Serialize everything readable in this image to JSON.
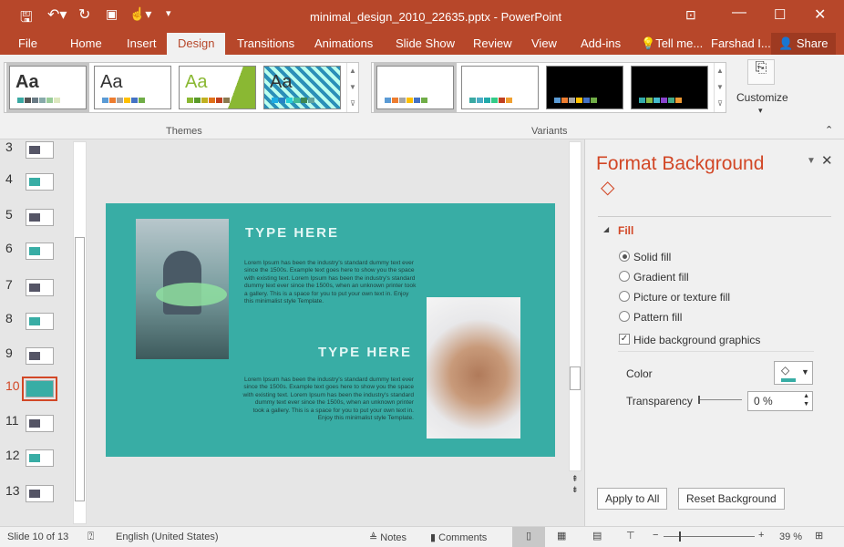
{
  "window": {
    "title": "minimal_design_2010_22635.pptx - PowerPoint"
  },
  "tabs": [
    "File",
    "Home",
    "Insert",
    "Design",
    "Transitions",
    "Animations",
    "Slide Show",
    "Review",
    "View",
    "Add-ins",
    "Tell me...",
    "Farshad I...",
    "Share"
  ],
  "active_tab": "Design",
  "ribbon": {
    "themes_label": "Themes",
    "variants_label": "Variants",
    "customize_label": "Customize",
    "themes": [
      {
        "aa": "Aa",
        "colors": [
          "#3aa9a3",
          "#555",
          "#6a7b85",
          "#8aa",
          "#9c9",
          "#dde8c0"
        ]
      },
      {
        "aa": "Aa",
        "colors": [
          "#5b9bd5",
          "#ed7d31",
          "#a5a5a5",
          "#ffc000",
          "#4472c4",
          "#70ad47"
        ]
      },
      {
        "aa": "Aa",
        "colors": [
          "#8ab833",
          "#5a9a2a",
          "#c0b020",
          "#e0701a",
          "#c04020",
          "#8a7a50"
        ]
      },
      {
        "aa": "Aa",
        "colors": [
          "#1cade4",
          "#2683c6",
          "#27ced7",
          "#42ba97",
          "#3e8853",
          "#62a39f"
        ]
      }
    ],
    "variants": [
      {
        "bg": "#ffffff",
        "colors": [
          "#5b9bd5",
          "#ed7d31",
          "#a5a5a5",
          "#ffc000",
          "#4472c4",
          "#70ad47"
        ]
      },
      {
        "bg": "#ffffff",
        "colors": [
          "#3aa9a3",
          "#4bacc6",
          "#2aa",
          "#3c8",
          "#c04020",
          "#f0a030"
        ]
      },
      {
        "bg": "#000000",
        "colors": [
          "#5b9bd5",
          "#ed7d31",
          "#a5a5a5",
          "#ffc000",
          "#4472c4",
          "#70ad47"
        ]
      },
      {
        "bg": "#000000",
        "colors": [
          "#3aa",
          "#8b4",
          "#4bc",
          "#84c",
          "#4a8",
          "#e93"
        ]
      }
    ]
  },
  "thumbnails": {
    "numbers": [
      "3",
      "4",
      "5",
      "6",
      "7",
      "8",
      "9",
      "10",
      "11",
      "12",
      "13"
    ],
    "selected": "10"
  },
  "slide": {
    "bg": "#38ada5",
    "heading1": "TYPE HERE",
    "body1": "Lorem Ipsum has been the industry's standard dummy text ever since the 1500s. Example text goes here to show you the space with existing text. Lorem Ipsum has been the industry's standard dummy text ever since the 1500s, when an unknown printer took a gallery. This is a space for you to put your own text in. Enjoy this minimalist style Template.",
    "heading2": "TYPE HERE",
    "body2": "Lorem Ipsum has been the industry's standard dummy text ever since the 1500s. Example text goes here to show you the space with existing text. Lorem Ipsum has been the industry's standard dummy text ever since the 1500s, when an unknown printer took a gallery. This is a space for you to put your own text in. Enjoy this minimalist style Template."
  },
  "pane": {
    "title": "Format Background",
    "section": "Fill",
    "options": [
      "Solid fill",
      "Gradient fill",
      "Picture or texture fill",
      "Pattern fill"
    ],
    "selected_option": "Solid fill",
    "hide_bg": "Hide background graphics",
    "hide_bg_checked": true,
    "color_label": "Color",
    "transparency_label": "Transparency",
    "transparency_value": "0 %",
    "apply_all": "Apply to All",
    "reset": "Reset Background",
    "accent": "#d24726"
  },
  "status": {
    "slide": "Slide 10 of 13",
    "language": "English (United States)",
    "notes": "Notes",
    "comments": "Comments",
    "zoom": "39 %"
  }
}
